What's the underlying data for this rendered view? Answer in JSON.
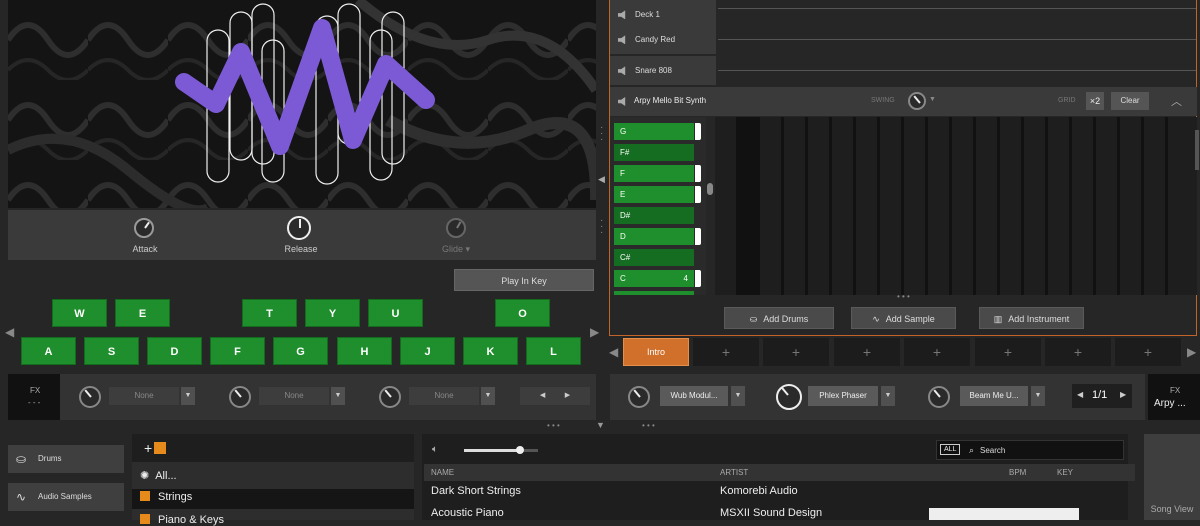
{
  "synth": {
    "knobs": [
      {
        "label": "Attack"
      },
      {
        "label": "Release"
      },
      {
        "label": "Glide ▾"
      }
    ],
    "play_in_key": "Play In Key",
    "upper_keys": [
      "W",
      "E",
      "T",
      "Y",
      "U",
      "O"
    ],
    "lower_keys": [
      "A",
      "S",
      "D",
      "F",
      "G",
      "H",
      "J",
      "K",
      "L"
    ]
  },
  "fx_left": {
    "label": "FX",
    "sub": "- - -",
    "slots": [
      "None",
      "None",
      "None"
    ]
  },
  "tracks": [
    "Deck 1",
    "Candy Red",
    "Snare 808"
  ],
  "active_track": {
    "name": "Arpy Mello Bit Synth",
    "swing": "SWING",
    "grid": "GRID",
    "grid_value": "×2",
    "clear": "Clear"
  },
  "piano_notes": [
    {
      "note": "G",
      "dark": false
    },
    {
      "note": "F#",
      "dark": true
    },
    {
      "note": "F",
      "dark": false
    },
    {
      "note": "E",
      "dark": false
    },
    {
      "note": "D#",
      "dark": true
    },
    {
      "note": "D",
      "dark": false
    },
    {
      "note": "C#",
      "dark": true
    },
    {
      "note": "C",
      "dark": false,
      "octave": "4"
    }
  ],
  "add_buttons": {
    "drums": "Add Drums",
    "sample": "Add Sample",
    "instrument": "Add Instrument"
  },
  "scene": {
    "intro": "Intro",
    "empty_slot": "+"
  },
  "fx_right": {
    "slots": [
      "Wub Modul...",
      "Phlex Phaser",
      "Beam Me U..."
    ],
    "page": "1/1",
    "fx": "FX",
    "instrument": "Arpy ..."
  },
  "dots": "• • •",
  "browser": {
    "side": [
      "Drums",
      "Audio Samples"
    ],
    "categories": [
      "All...",
      "Strings",
      "Piano & Keys"
    ],
    "search_all": "ALL",
    "search_placeholder": "Search",
    "columns": [
      "NAME",
      "ARTIST",
      "BPM",
      "KEY"
    ],
    "rows": [
      {
        "name": "Dark Short Strings",
        "artist": "Komorebi Audio"
      },
      {
        "name": "Acoustic Piano",
        "artist": "MSXII Sound Design"
      }
    ],
    "song_view": "Song View"
  },
  "colors": {
    "accent_green": "#1e8f2c",
    "accent_orange": "#c0642a",
    "wave_purple": "#7c5ad6"
  }
}
